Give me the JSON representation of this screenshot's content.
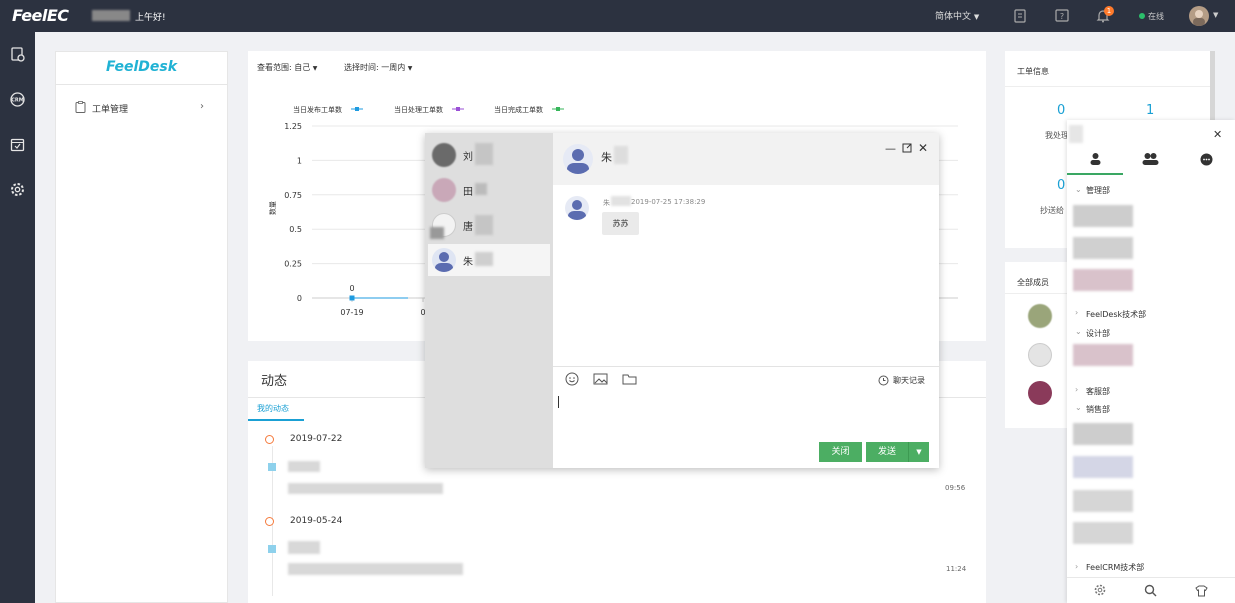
{
  "topbar": {
    "logo": "FeelEC",
    "greeting": "上午好!",
    "language": "简体中文",
    "notification_count": "1",
    "status": "在线"
  },
  "sidebar": {
    "logo": "FeelDesk",
    "menu_item": "工单管理"
  },
  "filters": {
    "scope_label": "查看范围: 自己",
    "time_label": "选择时间: 一周内"
  },
  "chart_data": {
    "type": "line",
    "legend": [
      "当日发布工单数",
      "当日处理工单数",
      "当日完成工单数"
    ],
    "ylabel": "数量",
    "yticks": [
      "1.25",
      "1",
      "0.75",
      "0.5",
      "0.25",
      "0"
    ],
    "x": [
      "07-19",
      "0"
    ],
    "series": [
      {
        "name": "当日发布工单数",
        "values": [
          0
        ],
        "color": "#1e9be0"
      },
      {
        "name": "当日处理工单数",
        "values": [],
        "color": "#9a4fd6"
      },
      {
        "name": "当日完成工单数",
        "values": [],
        "color": "#36b65a"
      }
    ],
    "data_labels": [
      "0"
    ],
    "ylim": [
      0,
      1.25
    ]
  },
  "dynamics": {
    "title": "动态",
    "tab": "我的动态",
    "entries": [
      {
        "date": "2019-07-22",
        "time": "09:56"
      },
      {
        "date": "2019-05-24",
        "time": "11:24"
      }
    ]
  },
  "info": {
    "title": "工单信息",
    "count_left": "0",
    "count_right": "1",
    "label_left": "我处理",
    "count_left2": "0",
    "label_left2": "抄送给"
  },
  "members": {
    "title": "全部成员"
  },
  "chat": {
    "contacts": [
      "刘",
      "田",
      "唐",
      "朱"
    ],
    "header_name": "朱",
    "message_meta": "2019-07-25 17:38:29",
    "message_sender": "朱",
    "message_text": "苏苏",
    "history_label": "聊天记录",
    "close_label": "关闭",
    "send_label": "发送"
  },
  "contacts_panel": {
    "groups": {
      "g1": "管理部",
      "g2": "FeelDesk技术部",
      "g3": "设计部",
      "g4": "客服部",
      "g5": "销售部",
      "g6": "FeelCRM技术部"
    }
  }
}
